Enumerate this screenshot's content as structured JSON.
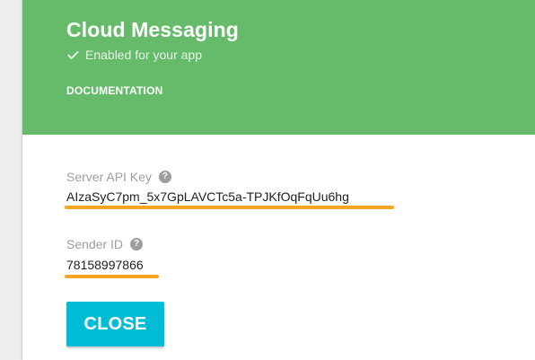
{
  "header": {
    "title": "Cloud Messaging",
    "status": "Enabled for your app",
    "documentation_link": "DOCUMENTATION",
    "status_icon": "check-icon",
    "background_color": "#66bb6a"
  },
  "fields": {
    "server_api_key": {
      "label": "Server API Key",
      "value": "AIzaSyC7pm_5x7GpLAVCTc5a-TPJKfOqFqUu6hg",
      "help_icon": "help-icon",
      "highlight_color": "#f6a623"
    },
    "sender_id": {
      "label": "Sender ID",
      "value": "78158997866",
      "help_icon": "help-icon",
      "highlight_color": "#f6a623"
    }
  },
  "icons": {
    "help_glyph": "?"
  },
  "actions": {
    "close_label": "CLOSE",
    "button_color": "#00bcd4"
  }
}
